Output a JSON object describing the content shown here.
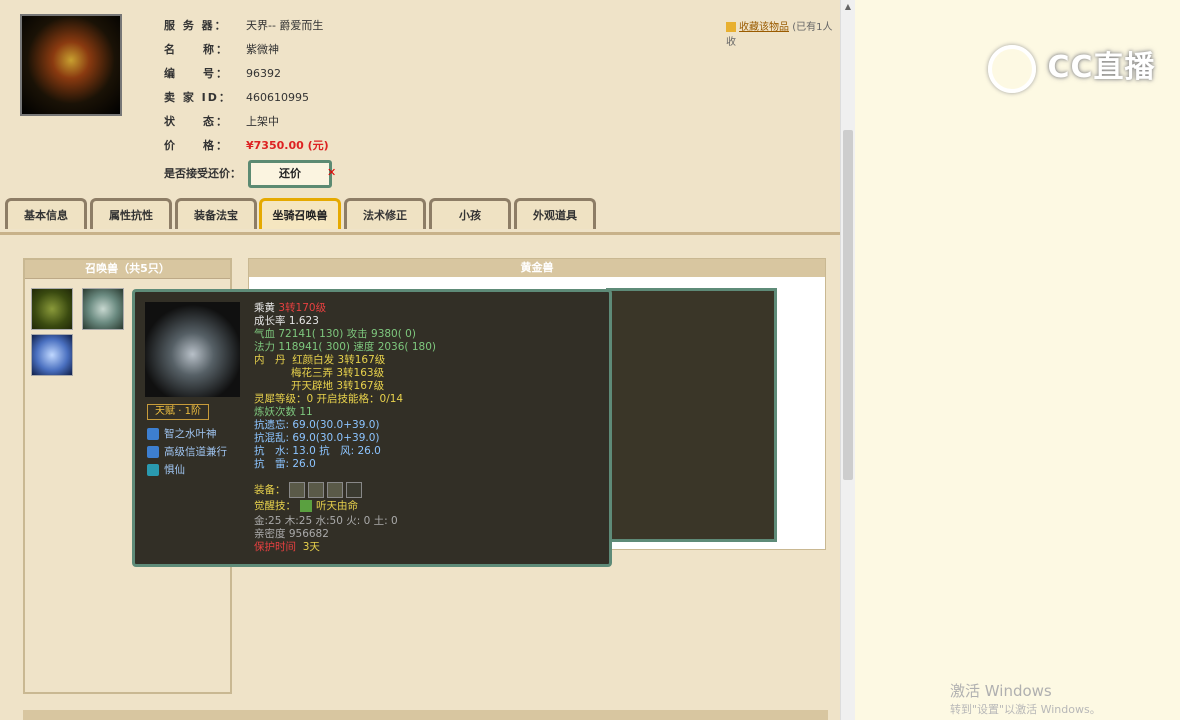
{
  "header": {
    "server_label": "服 务 器：",
    "server_value": "天界-- 爵爱而生",
    "name_label": "名　　称：",
    "name_value": "紫微神",
    "id_label": "编　　号：",
    "id_value": "96392",
    "seller_label": "卖 家 ID：",
    "seller_value": "460610995",
    "status_label": "状　　态：",
    "status_value": "上架中",
    "price_label": "价　　格：",
    "price_value": "¥7350.00 (元)",
    "counter_label": "是否接受还价：",
    "counter_button": "还价",
    "favorite_link": "收藏该物品",
    "favorite_count": "(已有1人收"
  },
  "tabs": [
    "基本信息",
    "属性抗性",
    "装备法宝",
    "坐骑召唤兽",
    "法术修正",
    "小孩",
    "外观道具"
  ],
  "active_tab": 3,
  "left_panel": {
    "title": "召唤兽（共5只）"
  },
  "right_panel": {
    "title": "黄金兽"
  },
  "tooltip": {
    "name": "乘黄",
    "level": "3转170级",
    "growth": "成长率 1.623",
    "hp_label": "气血",
    "hp": "72141( 130)",
    "atk_label": "攻击",
    "atk": "9380( 0)",
    "mp_label": "法力",
    "mp": "118941( 300)",
    "spd_label": "速度",
    "spd": "2036( 180)",
    "inner_label": "内　丹",
    "inner": [
      {
        "name": "红颜白发",
        "lvl": "3转167级"
      },
      {
        "name": "梅花三弄",
        "lvl": "3转163级"
      },
      {
        "name": "开天辟地",
        "lvl": "3转167级"
      }
    ],
    "spirit": "灵犀等级：0 开启技能格：0/14",
    "refine": "炼妖次数 11",
    "resist1": "抗遗忘: 69.0(30.0+39.0)",
    "resist2": "抗混乱: 69.0(30.0+39.0)",
    "resist3": "抗　水: 13.0 抗　风: 26.0",
    "resist4": "抗　雷: 26.0",
    "equip_label": "装备：",
    "awaken_label": "觉醒技：",
    "awaken": "听天由命",
    "elements": "金:25 木:25 水:50 火: 0 土: 0",
    "intimacy": "亲密度 956682",
    "protect_label": "保护时间",
    "protect_value": "3天",
    "talent": "天赋 · 1阶",
    "skills": [
      "智之水叶神",
      "高级信道兼行",
      "惧仙"
    ]
  },
  "overlay": {
    "logo": "CC直播",
    "win_activate": "激活 Windows",
    "win_activate_sub": "转到\"设置\"以激活 Windows。"
  }
}
